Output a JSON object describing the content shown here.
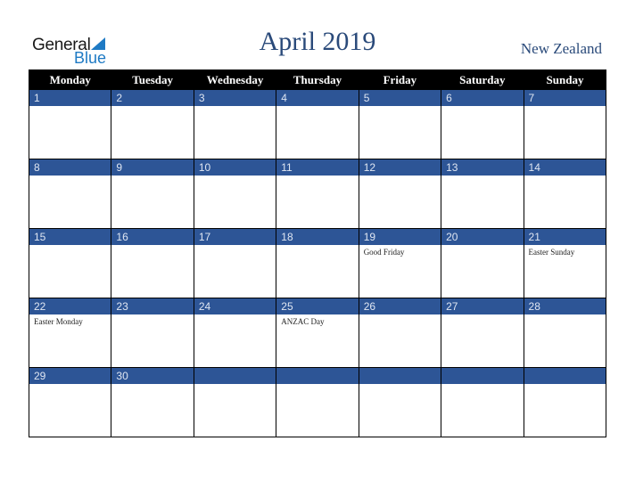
{
  "logo": {
    "line1": "General",
    "line2": "Blue"
  },
  "title": "April 2019",
  "region": "New Zealand",
  "weekdays": [
    "Monday",
    "Tuesday",
    "Wednesday",
    "Thursday",
    "Friday",
    "Saturday",
    "Sunday"
  ],
  "colors": {
    "header_bg": "#000000",
    "day_bar": "#2d5596",
    "title": "#2a4a7a",
    "logo_blue": "#1e7ac4"
  },
  "weeks": [
    [
      {
        "day": "1",
        "holiday": ""
      },
      {
        "day": "2",
        "holiday": ""
      },
      {
        "day": "3",
        "holiday": ""
      },
      {
        "day": "4",
        "holiday": ""
      },
      {
        "day": "5",
        "holiday": ""
      },
      {
        "day": "6",
        "holiday": ""
      },
      {
        "day": "7",
        "holiday": ""
      }
    ],
    [
      {
        "day": "8",
        "holiday": ""
      },
      {
        "day": "9",
        "holiday": ""
      },
      {
        "day": "10",
        "holiday": ""
      },
      {
        "day": "11",
        "holiday": ""
      },
      {
        "day": "12",
        "holiday": ""
      },
      {
        "day": "13",
        "holiday": ""
      },
      {
        "day": "14",
        "holiday": ""
      }
    ],
    [
      {
        "day": "15",
        "holiday": ""
      },
      {
        "day": "16",
        "holiday": ""
      },
      {
        "day": "17",
        "holiday": ""
      },
      {
        "day": "18",
        "holiday": ""
      },
      {
        "day": "19",
        "holiday": "Good Friday"
      },
      {
        "day": "20",
        "holiday": ""
      },
      {
        "day": "21",
        "holiday": "Easter Sunday"
      }
    ],
    [
      {
        "day": "22",
        "holiday": "Easter Monday"
      },
      {
        "day": "23",
        "holiday": ""
      },
      {
        "day": "24",
        "holiday": ""
      },
      {
        "day": "25",
        "holiday": "ANZAC Day"
      },
      {
        "day": "26",
        "holiday": ""
      },
      {
        "day": "27",
        "holiday": ""
      },
      {
        "day": "28",
        "holiday": ""
      }
    ],
    [
      {
        "day": "29",
        "holiday": ""
      },
      {
        "day": "30",
        "holiday": ""
      },
      {
        "day": "",
        "holiday": ""
      },
      {
        "day": "",
        "holiday": ""
      },
      {
        "day": "",
        "holiday": ""
      },
      {
        "day": "",
        "holiday": ""
      },
      {
        "day": "",
        "holiday": ""
      }
    ]
  ]
}
